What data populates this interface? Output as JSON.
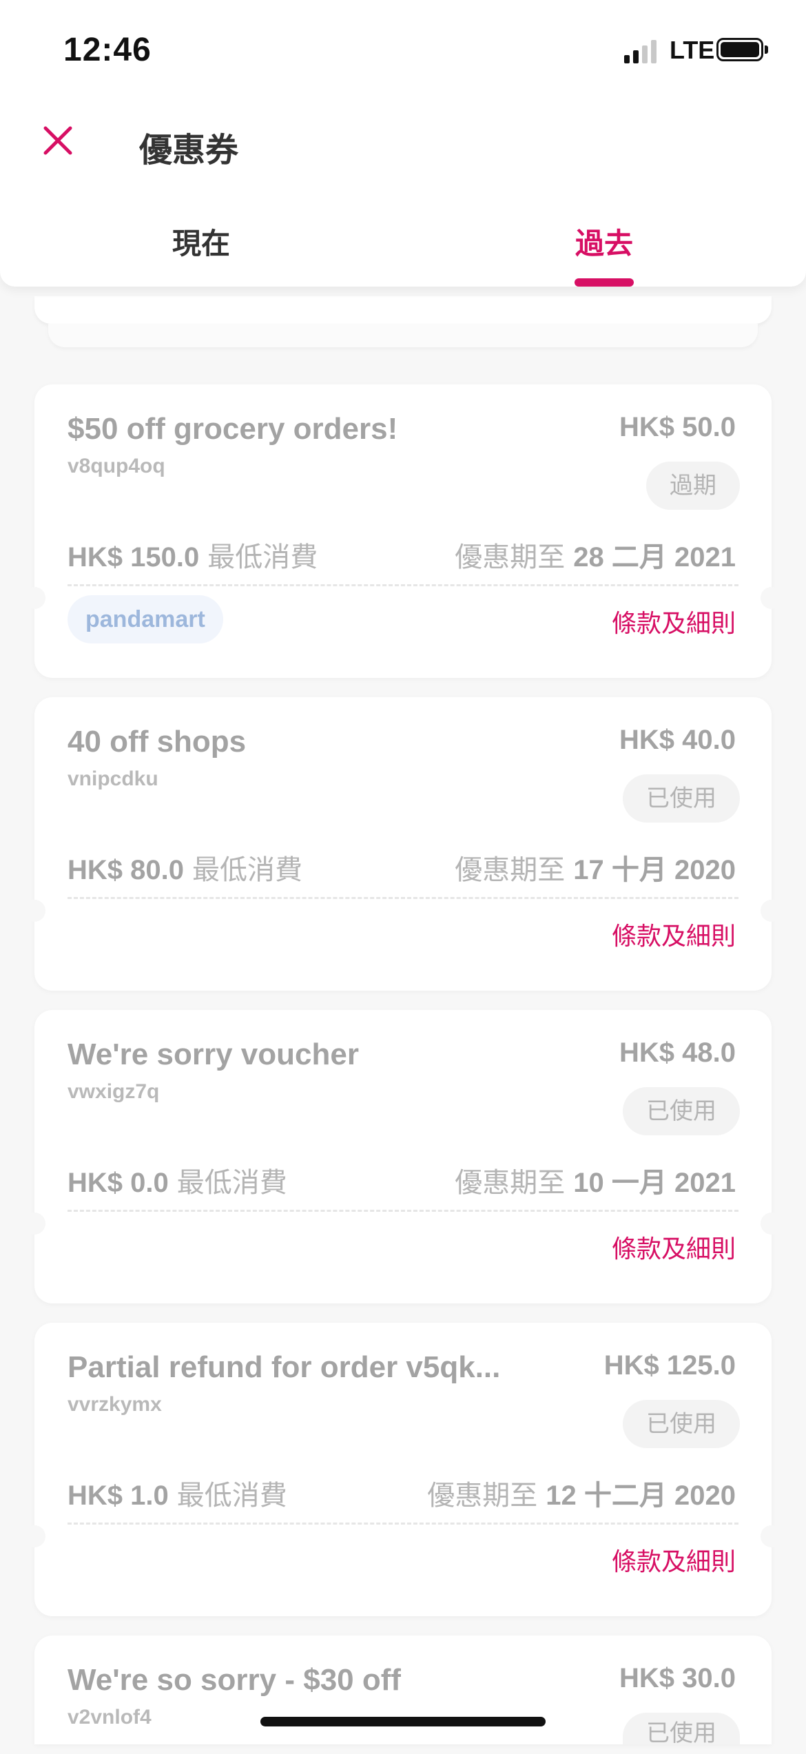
{
  "status_bar": {
    "time": "12:46",
    "network": "LTE"
  },
  "header": {
    "title": "優惠券"
  },
  "tabs": [
    {
      "label": "現在",
      "active": false
    },
    {
      "label": "過去",
      "active": true
    }
  ],
  "colors": {
    "accent": "#d70f64",
    "muted_text": "#a3a3a3",
    "tag_blue": "#9db7dc"
  },
  "vouchers": [
    {
      "title": "$50 off grocery orders!",
      "code": "v8qup4oq",
      "amount": "HK$ 50.0",
      "status": "過期",
      "min_spend": "HK$ 150.0",
      "min_label": "最低消費",
      "valid_label": "優惠期至",
      "valid_date": "28 二月 2021",
      "tag": "pandamart",
      "terms": "條款及細則"
    },
    {
      "title": "40 off shops",
      "code": "vnipcdku",
      "amount": "HK$ 40.0",
      "status": "已使用",
      "min_spend": "HK$ 80.0",
      "min_label": "最低消費",
      "valid_label": "優惠期至",
      "valid_date": "17 十月 2020",
      "terms": "條款及細則"
    },
    {
      "title": "We're sorry voucher",
      "code": "vwxigz7q",
      "amount": "HK$ 48.0",
      "status": "已使用",
      "min_spend": "HK$ 0.0",
      "min_label": "最低消費",
      "valid_label": "優惠期至",
      "valid_date": "10 一月 2021",
      "terms": "條款及細則"
    },
    {
      "title": "Partial refund for order v5qk...",
      "code": "vvrzkymx",
      "amount": "HK$ 125.0",
      "status": "已使用",
      "min_spend": "HK$ 1.0",
      "min_label": "最低消費",
      "valid_label": "優惠期至",
      "valid_date": "12 十二月 2020",
      "terms": "條款及細則"
    },
    {
      "title": "We're so sorry - $30 off",
      "code": "v2vnlof4",
      "amount": "HK$ 30.0",
      "status": "已使用"
    }
  ]
}
